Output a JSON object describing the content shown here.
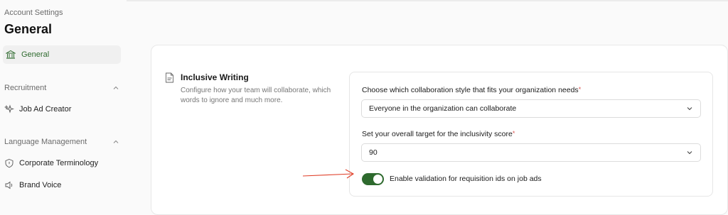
{
  "header": {
    "breadcrumb": "Account Settings",
    "title": "General"
  },
  "sidebar": {
    "active": {
      "label": "General",
      "icon": "bank-icon"
    },
    "sections": [
      {
        "label": "Recruitment",
        "items": [
          {
            "label": "Job Ad Creator",
            "icon": "sparkle-icon"
          }
        ]
      },
      {
        "label": "Language Management",
        "items": [
          {
            "label": "Corporate Terminology",
            "icon": "shield-icon"
          },
          {
            "label": "Brand Voice",
            "icon": "speaker-icon"
          }
        ]
      }
    ]
  },
  "main": {
    "section": {
      "title": "Inclusive Writing",
      "description": "Configure how your team will collaborate, which words to ignore and much more."
    },
    "collaboration": {
      "label": "Choose which collaboration style that fits your organization needs",
      "value": "Everyone in the organization can collaborate"
    },
    "target": {
      "label": "Set your overall target for the inclusivity score",
      "value": "90"
    },
    "toggle": {
      "label": "Enable validation for requisition ids on job ads",
      "on": true
    }
  },
  "colors": {
    "accent": "#2e6a2e",
    "required": "#d9534f",
    "annotation": "#e0412b"
  }
}
